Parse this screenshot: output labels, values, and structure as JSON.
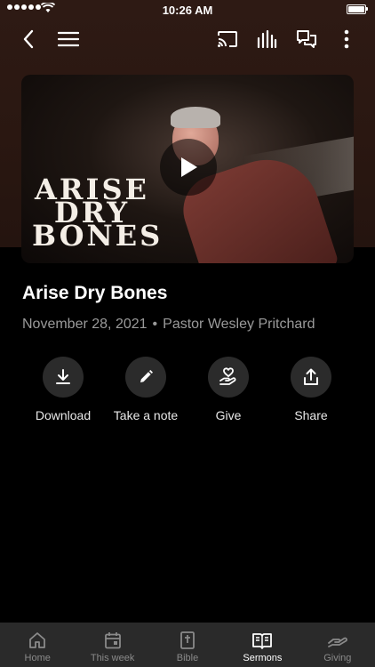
{
  "status_bar": {
    "time": "10:26 AM"
  },
  "sermon": {
    "title": "Arise Dry Bones",
    "date": "November 28, 2021",
    "separator": "•",
    "speaker": "Pastor Wesley Pritchard",
    "artwork_text": [
      "ARISE",
      "DRY",
      "BONES"
    ]
  },
  "actions": [
    {
      "label": "Download",
      "icon": "download-icon"
    },
    {
      "label": "Take a note",
      "icon": "pencil-icon"
    },
    {
      "label": "Give",
      "icon": "heart-hand-icon"
    },
    {
      "label": "Share",
      "icon": "share-icon"
    }
  ],
  "tabs": [
    {
      "label": "Home",
      "icon": "home-icon",
      "active": false
    },
    {
      "label": "This week",
      "icon": "calendar-icon",
      "active": false
    },
    {
      "label": "Bible",
      "icon": "bible-icon",
      "active": false
    },
    {
      "label": "Sermons",
      "icon": "open-book-icon",
      "active": true
    },
    {
      "label": "Giving",
      "icon": "giving-hand-icon",
      "active": false
    }
  ],
  "colors": {
    "background": "#000000",
    "header": "#2e1a14",
    "tab_bar": "#2a2a2a",
    "action_circle": "#2b2b2b",
    "meta_text": "#9a9a9a"
  }
}
